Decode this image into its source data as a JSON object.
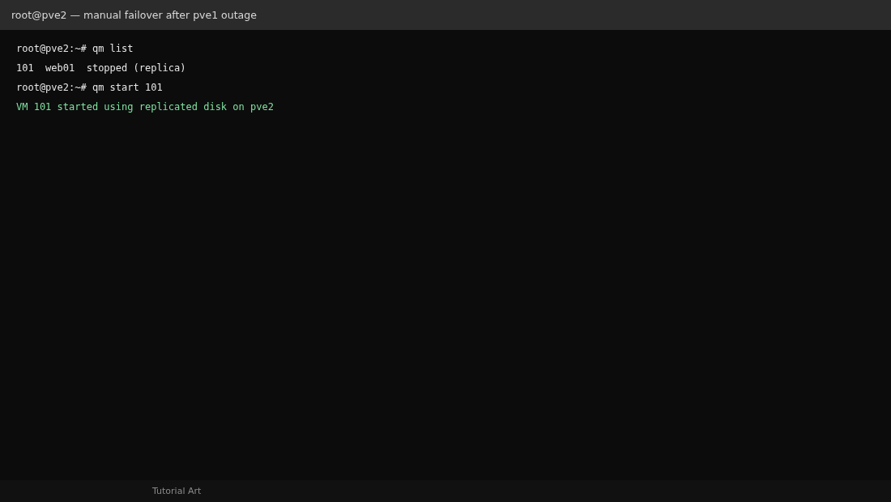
{
  "window": {
    "title": "root@pve2 — manual failover after pve1 outage"
  },
  "terminal": {
    "lines": [
      {
        "kind": "command",
        "text": "root@pve2:~# qm list"
      },
      {
        "kind": "output",
        "text": "101  web01  stopped (replica)"
      },
      {
        "kind": "command",
        "text": "root@pve2:~# qm start 101"
      },
      {
        "kind": "success",
        "text": "VM 101 started using replicated disk on pve2"
      }
    ]
  },
  "footer": {
    "text": "Tutorial Art"
  }
}
